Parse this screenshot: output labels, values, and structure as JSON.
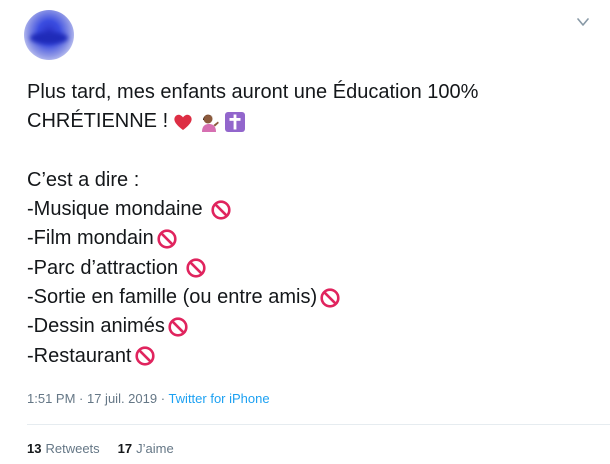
{
  "tweet": {
    "lines": [
      {
        "text": "Plus tard, mes enfants auront une Éducation 100%",
        "emojis": []
      },
      {
        "text": "CHRÉTIENNE !",
        "emojis": [
          "red-heart-icon",
          "person-tipping-hand-icon",
          "latin-cross-icon"
        ]
      },
      {
        "text": "",
        "emojis": []
      },
      {
        "text": "C’est a dire :",
        "emojis": []
      },
      {
        "text": "-Musique mondaine",
        "emojis": [
          "prohibited-icon"
        ],
        "gap": true
      },
      {
        "text": "-Film mondain",
        "emojis": [
          "prohibited-icon"
        ],
        "gap": false
      },
      {
        "text": "-Parc d’attraction",
        "emojis": [
          "prohibited-icon"
        ],
        "gap": true
      },
      {
        "text": "-Sortie en famille (ou entre amis)",
        "emojis": [
          "prohibited-icon"
        ],
        "gap": false
      },
      {
        "text": "-Dessin animés",
        "emojis": [
          "prohibited-icon"
        ],
        "gap": false
      },
      {
        "text": "-Restaurant",
        "emojis": [
          "prohibited-icon"
        ],
        "gap": false
      }
    ],
    "meta": {
      "time": "1:51 PM",
      "separator1": " · ",
      "date": "17 juil. 2019",
      "separator2": " · ",
      "source": "Twitter for iPhone"
    },
    "stats": {
      "retweets_count": "13",
      "retweets_label": "Retweets",
      "likes_count": "17",
      "likes_label": "J’aime"
    },
    "icons": {
      "avatar": "avatar-image",
      "menu": "chevron-down-icon"
    },
    "colors": {
      "text": "#14171a",
      "meta": "#657786",
      "link": "#1da1f2",
      "prohibited": "#e0245e",
      "heart": "#e0245e",
      "cross_bg": "#8a5bd6"
    }
  }
}
